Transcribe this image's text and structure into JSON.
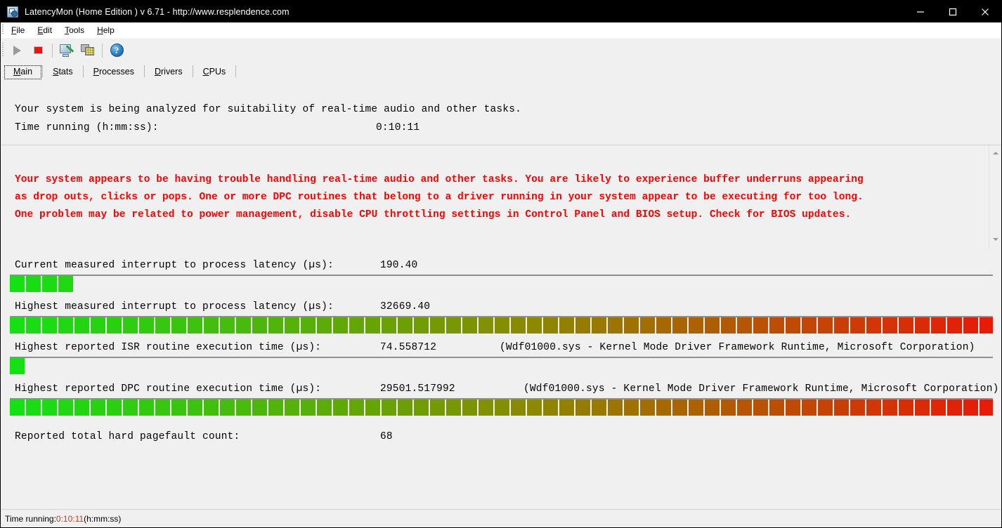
{
  "window": {
    "title": "LatencyMon  (Home Edition )  v 6.71 - http://www.resplendence.com",
    "icon": "latencymon-app-icon",
    "minimize_label": "Minimize",
    "maximize_label": "Maximize",
    "close_label": "Close"
  },
  "menu": {
    "items": [
      {
        "label": "File",
        "accel": "F"
      },
      {
        "label": "Edit",
        "accel": "E"
      },
      {
        "label": "Tools",
        "accel": "T"
      },
      {
        "label": "Help",
        "accel": "H"
      }
    ]
  },
  "toolbar": {
    "buttons": [
      {
        "name": "start-monitoring-button",
        "icon": "play-icon",
        "label": "Start monitoring",
        "enabled": false
      },
      {
        "name": "stop-monitoring-button",
        "icon": "stop-icon",
        "label": "Stop monitoring",
        "enabled": true
      },
      {
        "name": "system-info-button",
        "icon": "monitor-wand-icon",
        "label": "System information",
        "enabled": true
      },
      {
        "name": "windows-button",
        "icon": "cascade-windows-icon",
        "label": "Windows",
        "enabled": true
      },
      {
        "name": "help-button",
        "icon": "help-circle-icon",
        "label": "Help",
        "enabled": true
      }
    ]
  },
  "tabs": [
    {
      "label": "Main",
      "accel": "M",
      "selected": true
    },
    {
      "label": "Stats",
      "accel": "S",
      "selected": false
    },
    {
      "label": "Processes",
      "accel": "P",
      "selected": false
    },
    {
      "label": "Drivers",
      "accel": "D",
      "selected": false
    },
    {
      "label": "CPUs",
      "accel": "C",
      "selected": false
    }
  ],
  "main": {
    "analyzed_text": "Your system is being analyzed for suitability of real-time audio and other tasks.",
    "time_running_label": "Time running (h:mm:ss):",
    "time_running_value": "0:10:11",
    "warning_color": "#ff0000",
    "warning_lines": [
      "Your system appears to be having trouble handling real-time audio and other tasks. You are likely to experience buffer underruns appearing",
      "as drop outs, clicks or pops. One or more DPC routines that belong to a driver running in your system appear to be executing for too long.",
      "One problem may be related to power management, disable CPU throttling settings in Control Panel and BIOS setup. Check for BIOS updates."
    ],
    "metrics": [
      {
        "name": "current-interrupt-to-process-latency",
        "label": "Current measured interrupt to process latency (µs):",
        "value": "190.40",
        "extra": "",
        "bar_segments": 4,
        "bar_total_segments": 64,
        "bar_seg_width": 21,
        "bar_full_width": 1399
      },
      {
        "name": "highest-interrupt-to-process-latency",
        "label": "Highest measured interrupt to process latency (µs):",
        "value": "32669.40",
        "extra": "",
        "bar_segments": 64,
        "bar_total_segments": 64,
        "bar_seg_width": 21,
        "bar_full_width": 1399
      },
      {
        "name": "highest-isr-routine-execution-time",
        "label": "Highest reported ISR routine execution time (µs):",
        "value": "74.558712",
        "extra": "(Wdf01000.sys - Kernel Mode Driver Framework Runtime, Microsoft Corporation)",
        "bar_segments": 1,
        "bar_total_segments": 64,
        "bar_seg_width": 21,
        "bar_full_width": 1399
      },
      {
        "name": "highest-dpc-routine-execution-time",
        "label": "Highest reported DPC routine execution time (µs):",
        "value": "29501.517992",
        "extra": "(Wdf01000.sys - Kernel Mode Driver Framework Runtime, Microsoft Corporation)",
        "bar_segments": 62,
        "bar_total_segments": 64,
        "bar_seg_width": 21,
        "bar_full_width": 1399
      }
    ],
    "pagefault_label": "Reported total hard pagefault count:",
    "pagefault_value": "68"
  },
  "statusbar": {
    "prefix": "Time running: ",
    "time": "0:10:11",
    "suffix": "  (h:mm:ss)",
    "accent_color": "#c83c1e"
  }
}
